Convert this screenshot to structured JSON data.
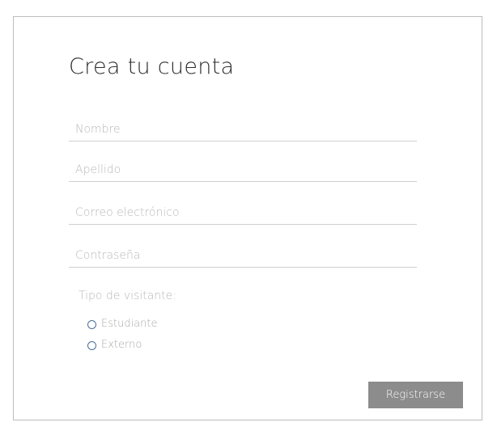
{
  "form": {
    "title": "Crea tu cuenta",
    "fields": {
      "first_name_placeholder": "Nombre",
      "last_name_placeholder": "Apellido",
      "email_placeholder": "Correo electrónico",
      "password_placeholder": "Contraseña"
    },
    "visitor_type": {
      "label": "Tipo de visitante:",
      "options": [
        "Estudiante",
        "Externo"
      ],
      "selected": null
    },
    "submit_label": "Registrarse"
  },
  "colors": {
    "submit_background": "#8c8c8c",
    "radio_border": "#4a6f9a",
    "field_border": "#cfcfcf",
    "card_border": "#bdbdbd"
  }
}
